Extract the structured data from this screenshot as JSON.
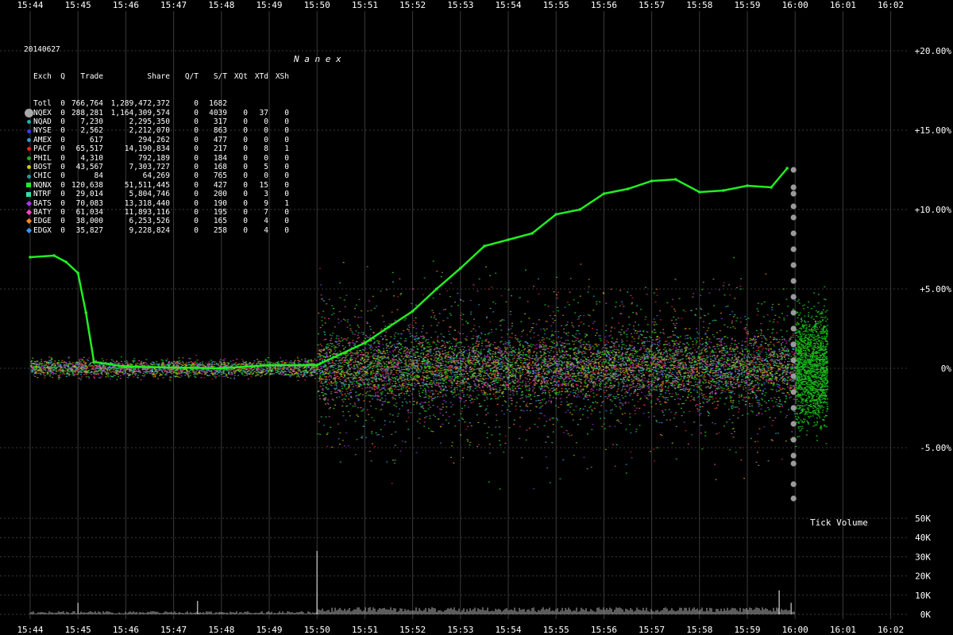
{
  "chart_data": [
    {
      "type": "scatter",
      "title": "",
      "date": "20140627",
      "watermark": "N a n e x",
      "xlabel": "",
      "ylabel": "",
      "x_ticks": [
        "15:44",
        "15:45",
        "15:46",
        "15:47",
        "15:48",
        "15:49",
        "15:50",
        "15:51",
        "15:52",
        "15:53",
        "15:54",
        "15:55",
        "15:56",
        "15:57",
        "15:58",
        "15:59",
        "16:00",
        "16:01",
        "16:02"
      ],
      "y_unit": "percent",
      "ylim": [
        -7.0,
        21.0
      ],
      "y_ticks": [
        20,
        15,
        10,
        5,
        0,
        -5
      ],
      "y_tick_labels": [
        "+20.00%",
        "+15.00%",
        "+10.00%",
        "+5.00%",
        "0%",
        "-5.00%"
      ],
      "grid": true,
      "series": [
        {
          "name": "NQNX",
          "color": "#22ee22",
          "points": [
            [
              "15:44",
              7.0
            ],
            [
              "15:44:30",
              7.1
            ],
            [
              "15:44:45",
              6.7
            ],
            [
              "15:45",
              6.0
            ],
            [
              "15:45:10",
              3.5
            ],
            [
              "15:45:20",
              0.4
            ],
            [
              "15:46",
              0.1
            ],
            [
              "15:48",
              0.0
            ],
            [
              "15:49",
              0.2
            ],
            [
              "15:50",
              0.2
            ],
            [
              "15:50:30",
              0.9
            ],
            [
              "15:51",
              1.6
            ],
            [
              "15:51:30",
              2.6
            ],
            [
              "15:52",
              3.6
            ],
            [
              "15:52:30",
              5.0
            ],
            [
              "15:53",
              6.3
            ],
            [
              "15:53:30",
              7.7
            ],
            [
              "15:54",
              8.1
            ],
            [
              "15:54:30",
              8.5
            ],
            [
              "15:55",
              9.7
            ],
            [
              "15:55:30",
              10.0
            ],
            [
              "15:56",
              11.0
            ],
            [
              "15:56:30",
              11.3
            ],
            [
              "15:57",
              11.8
            ],
            [
              "15:57:30",
              11.9
            ],
            [
              "15:58",
              11.1
            ],
            [
              "15:58:30",
              11.2
            ],
            [
              "15:59",
              11.5
            ],
            [
              "15:59:30",
              11.4
            ],
            [
              "15:59:50",
              12.6
            ]
          ]
        },
        {
          "name": "NQEX",
          "color": "#9a9a9a",
          "closing_cross_time": "16:00",
          "price_levels": [
            12.5,
            11.4,
            11.0,
            10.2,
            9.5,
            8.5,
            7.5,
            6.5,
            5.5,
            4.5,
            3.5,
            2.5,
            1.5,
            0.5,
            -0.5,
            -1.5,
            -2.5,
            -3.5,
            -4.5,
            -5.5,
            -6.0,
            -7.3,
            -8.2
          ]
        }
      ]
    },
    {
      "type": "bar",
      "title": "",
      "label": "Tick Volume",
      "x_ticks": [
        "15:44",
        "15:45",
        "15:46",
        "15:47",
        "15:48",
        "15:49",
        "15:50",
        "15:51",
        "15:52",
        "15:53",
        "15:54",
        "15:55",
        "15:56",
        "15:57",
        "15:58",
        "15:59",
        "16:00",
        "16:01",
        "16:02"
      ],
      "ylim": [
        0,
        50000
      ],
      "y_ticks": [
        50000,
        40000,
        30000,
        20000,
        10000,
        0
      ],
      "y_tick_labels": [
        "50K",
        "40K",
        "30K",
        "20K",
        "10K",
        "0K"
      ],
      "grid": true,
      "spikes": [
        {
          "time": "15:45",
          "value": 6000
        },
        {
          "time": "15:47:30",
          "value": 7000
        },
        {
          "time": "15:50",
          "value": 12000
        },
        {
          "time": "15:50",
          "value": 33000
        },
        {
          "time": "15:59:40",
          "value": 12500
        },
        {
          "time": "15:59:55",
          "value": 6000
        }
      ]
    }
  ],
  "stats_table": {
    "date": "20140627",
    "header": [
      "Exch",
      "Q",
      "Trade",
      "Share",
      "Q/T",
      "S/T",
      "XQt",
      "XTd",
      "XSh"
    ],
    "rows": [
      {
        "exch": "Totl",
        "q": "0",
        "trade": "766,764",
        "share": "1,289,472,372",
        "qt": "0",
        "st": "1682",
        "xqt": "",
        "xtd": "",
        "xsh": "",
        "marker": "none",
        "color": "#ffffff"
      },
      {
        "exch": "NQEX",
        "q": "0",
        "trade": "288,281",
        "share": "1,164,309,574",
        "qt": "0",
        "st": "4039",
        "xqt": "0",
        "xtd": "37",
        "xsh": "0",
        "marker": "big",
        "color": "#a8a8a8"
      },
      {
        "exch": "NQAD",
        "q": "0",
        "trade": "7,230",
        "share": "2,295,350",
        "qt": "0",
        "st": "317",
        "xqt": "0",
        "xtd": "0",
        "xsh": "0",
        "marker": "dot",
        "color": "#20b2aa"
      },
      {
        "exch": "NYSE",
        "q": "0",
        "trade": "2,562",
        "share": "2,212,070",
        "qt": "0",
        "st": "863",
        "xqt": "0",
        "xtd": "0",
        "xsh": "0",
        "marker": "dot",
        "color": "#3a3aff"
      },
      {
        "exch": "AMEX",
        "q": "0",
        "trade": "617",
        "share": "294,262",
        "qt": "0",
        "st": "477",
        "xqt": "0",
        "xtd": "0",
        "xsh": "0",
        "marker": "dot",
        "color": "#3399cc"
      },
      {
        "exch": "PACF",
        "q": "0",
        "trade": "65,517",
        "share": "14,190,834",
        "qt": "0",
        "st": "217",
        "xqt": "0",
        "xtd": "8",
        "xsh": "1",
        "marker": "dot",
        "color": "#ee2222"
      },
      {
        "exch": "PHIL",
        "q": "0",
        "trade": "4,310",
        "share": "792,189",
        "qt": "0",
        "st": "184",
        "xqt": "0",
        "xtd": "0",
        "xsh": "0",
        "marker": "dot",
        "color": "#22aa22"
      },
      {
        "exch": "BOST",
        "q": "0",
        "trade": "43,567",
        "share": "7,303,727",
        "qt": "0",
        "st": "168",
        "xqt": "0",
        "xtd": "5",
        "xsh": "0",
        "marker": "dot",
        "color": "#cccc00"
      },
      {
        "exch": "CHIC",
        "q": "0",
        "trade": "84",
        "share": "64,269",
        "qt": "0",
        "st": "765",
        "xqt": "0",
        "xtd": "0",
        "xsh": "0",
        "marker": "dot",
        "color": "#1aa0a0"
      },
      {
        "exch": "NQNX",
        "q": "0",
        "trade": "120,638",
        "share": "51,511,445",
        "qt": "0",
        "st": "427",
        "xqt": "0",
        "xtd": "15",
        "xsh": "0",
        "marker": "sq",
        "color": "#22ee22"
      },
      {
        "exch": "NTRF",
        "q": "0",
        "trade": "29,014",
        "share": "5,804,746",
        "qt": "0",
        "st": "200",
        "xqt": "0",
        "xtd": "3",
        "xsh": "0",
        "marker": "sq",
        "color": "#33ddaa"
      },
      {
        "exch": "BATS",
        "q": "0",
        "trade": "70,083",
        "share": "13,318,440",
        "qt": "0",
        "st": "190",
        "xqt": "0",
        "xtd": "9",
        "xsh": "1",
        "marker": "dia",
        "color": "#aa33ee"
      },
      {
        "exch": "BATY",
        "q": "0",
        "trade": "61,034",
        "share": "11,893,116",
        "qt": "0",
        "st": "195",
        "xqt": "0",
        "xtd": "7",
        "xsh": "0",
        "marker": "dia",
        "color": "#ff44cc"
      },
      {
        "exch": "EDGE",
        "q": "0",
        "trade": "38,000",
        "share": "6,253,526",
        "qt": "0",
        "st": "165",
        "xqt": "0",
        "xtd": "4",
        "xsh": "0",
        "marker": "dia",
        "color": "#ff8822"
      },
      {
        "exch": "EDGX",
        "q": "0",
        "trade": "35,827",
        "share": "9,228,824",
        "qt": "0",
        "st": "258",
        "xqt": "0",
        "xtd": "4",
        "xsh": "0",
        "marker": "dia",
        "color": "#3399ff"
      }
    ]
  }
}
